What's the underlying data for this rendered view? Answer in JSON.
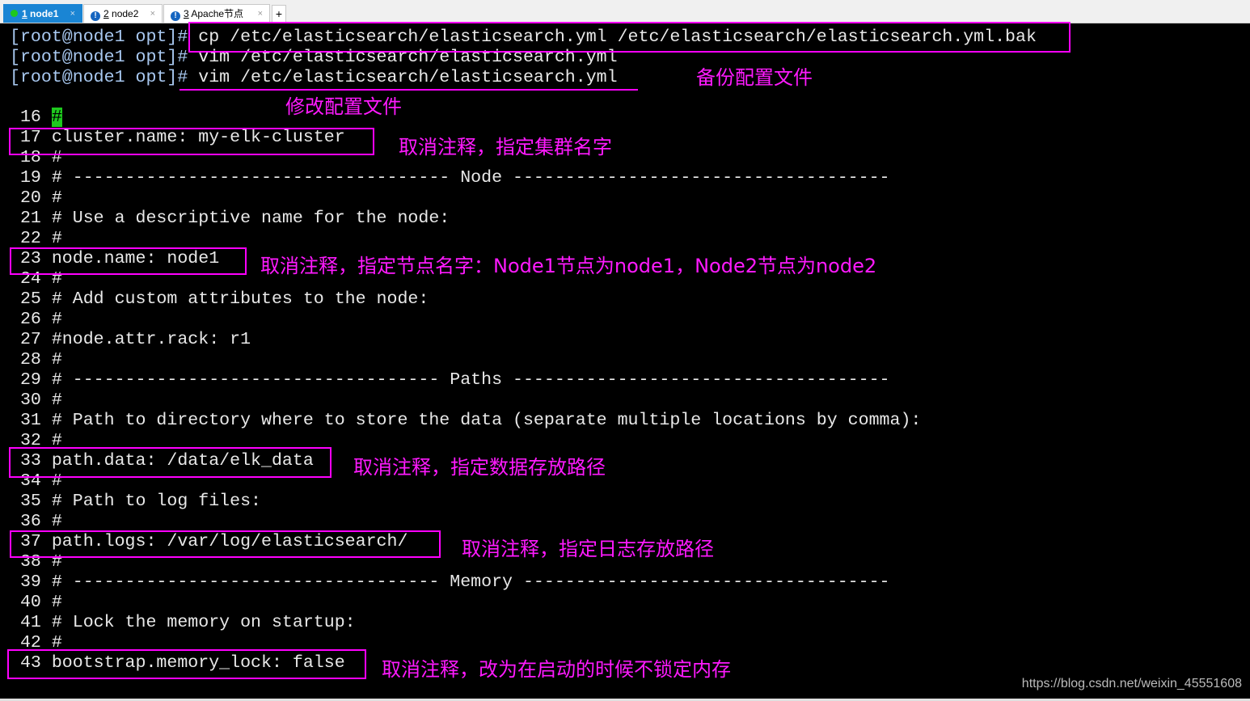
{
  "tabs": [
    {
      "num": "1",
      "label": "node1",
      "status": "connected",
      "active": true
    },
    {
      "num": "2",
      "label": "node2",
      "status": "warning"
    },
    {
      "num": "3",
      "label": "Apache节点",
      "status": "warning"
    }
  ],
  "new_tab": "+",
  "close": "×",
  "warn_glyph": "!",
  "prompt": "[root@node1 opt]#",
  "commands": [
    " cp /etc/elasticsearch/elasticsearch.yml /etc/elasticsearch/elasticsearch.yml.bak",
    " vim /etc/elasticsearch/elasticsearch.yml",
    " vim /etc/elasticsearch/elasticsearch.yml"
  ],
  "cursor_line_prefix": " 16 ",
  "cursor_char": "#",
  "lines": [
    " 17 cluster.name: my-elk-cluster",
    " 18 #",
    " 19 # ------------------------------------ Node ------------------------------------",
    " 20 #",
    " 21 # Use a descriptive name for the node:",
    " 22 #",
    " 23 node.name: node1",
    " 24 #",
    " 25 # Add custom attributes to the node:",
    " 26 #",
    " 27 #node.attr.rack: r1",
    " 28 #",
    " 29 # ----------------------------------- Paths ------------------------------------",
    " 30 #",
    " 31 # Path to directory where to store the data (separate multiple locations by comma):",
    " 32 #",
    " 33 path.data: /data/elk_data",
    " 34 #",
    " 35 # Path to log files:",
    " 36 #",
    " 37 path.logs: /var/log/elasticsearch/",
    " 38 #",
    " 39 # ----------------------------------- Memory -----------------------------------",
    " 40 #",
    " 41 # Lock the memory on startup:",
    " 42 #",
    " 43 bootstrap.memory_lock: false"
  ],
  "annotations": {
    "backup": "备份配置文件",
    "modify": "修改配置文件",
    "cluster": "取消注释，指定集群名字",
    "node": "取消注释，指定节点名字：Node1节点为node1，Node2节点为node2",
    "data": "取消注释，指定数据存放路径",
    "logs": "取消注释，指定日志存放路径",
    "memory": "取消注释，改为在启动的时候不锁定内存"
  },
  "watermark": "https://blog.csdn.net/weixin_45551608",
  "colors": {
    "annotation": "#ff00ff",
    "active_tab": "#1a85d4",
    "prompt": "#a8c8f0"
  }
}
